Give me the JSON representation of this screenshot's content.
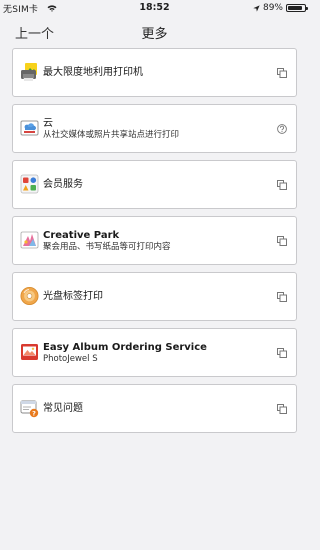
{
  "status_bar": {
    "carrier": "无SIM卡",
    "time": "18:52",
    "battery_text": "89%",
    "battery_level": 0.89
  },
  "nav": {
    "back_label": "上一个",
    "title": "更多"
  },
  "menu": {
    "items": [
      {
        "title": "最大限度地利用打印机",
        "subtitle": "",
        "icon": "printer-photo-icon",
        "trailing": "external-link-icon"
      },
      {
        "title": "云",
        "subtitle": "从社交媒体或照片共享站点进行打印",
        "icon": "cloud-print-icon",
        "trailing": "help-icon"
      },
      {
        "title": "会员服务",
        "subtitle": "",
        "icon": "member-services-icon",
        "trailing": "external-link-icon"
      },
      {
        "title": "Creative Park",
        "subtitle": "聚会用品、书写纸品等可打印内容",
        "icon": "creative-park-icon",
        "trailing": "external-link-icon"
      },
      {
        "title": "光盘标签打印",
        "subtitle": "",
        "icon": "disc-label-icon",
        "trailing": "external-link-icon"
      },
      {
        "title": "Easy Album Ordering Service",
        "subtitle": "PhotoJewel S",
        "icon": "photo-album-icon",
        "trailing": "external-link-icon"
      },
      {
        "title": "常见问题",
        "subtitle": "",
        "icon": "faq-icon",
        "trailing": "external-link-icon"
      }
    ]
  }
}
